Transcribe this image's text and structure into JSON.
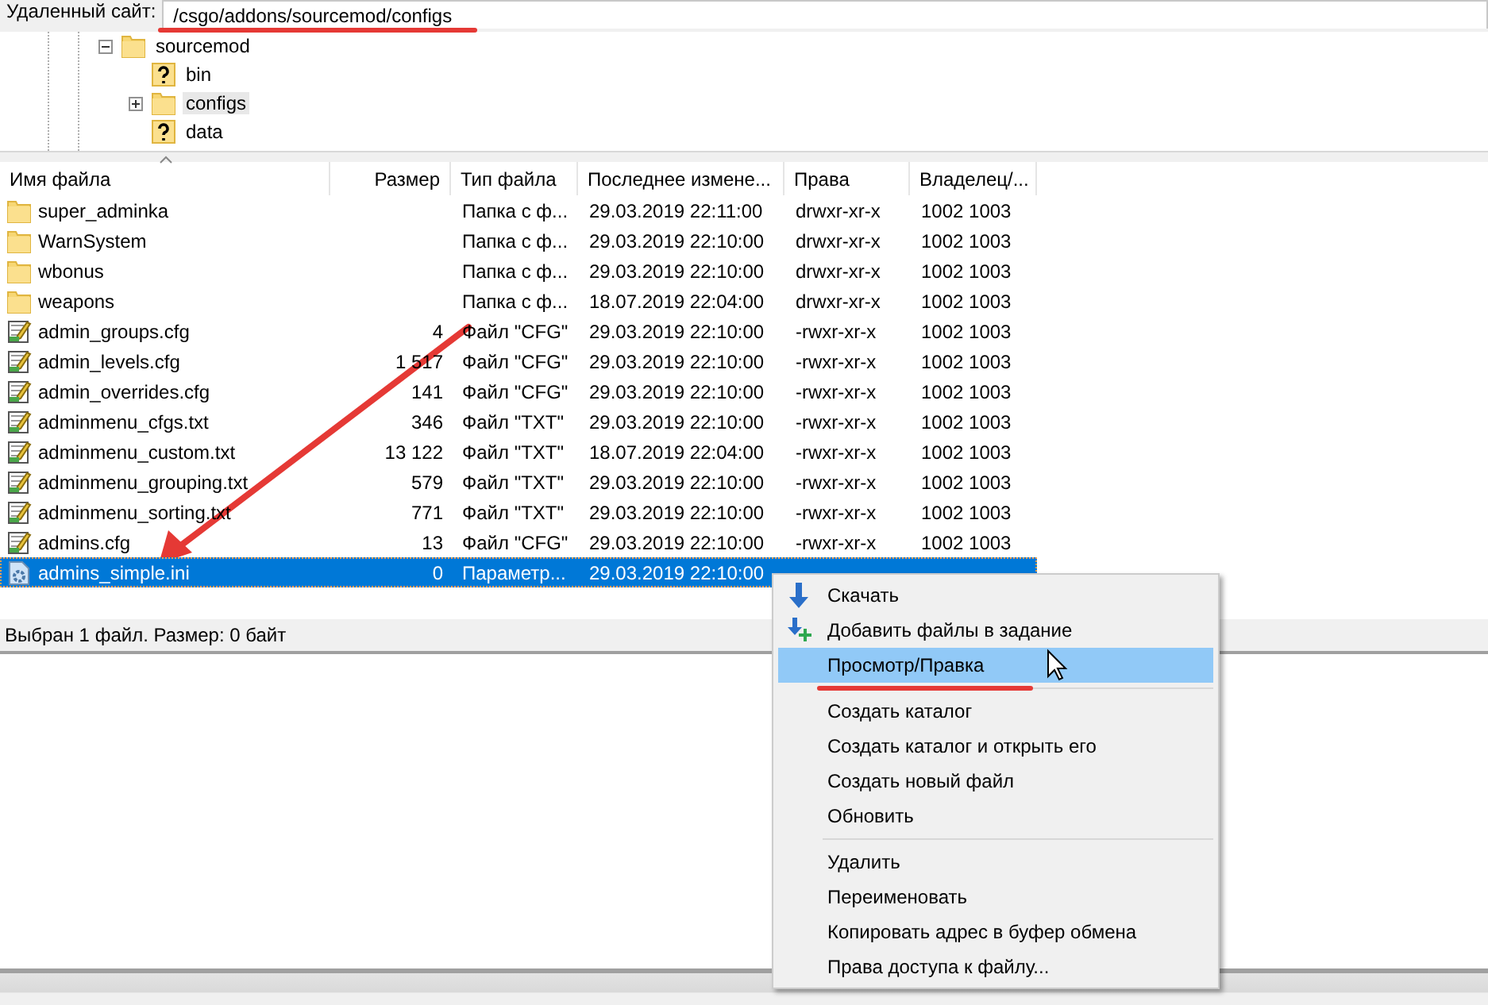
{
  "remote_site": {
    "label": "Удаленный сайт:",
    "path": "/csgo/addons/sourcemod/configs"
  },
  "tree": [
    {
      "name": "sourcemod",
      "kind": "folder",
      "expanded": true,
      "selected": false,
      "children": [
        {
          "name": "bin",
          "kind": "unknown",
          "selected": false
        },
        {
          "name": "configs",
          "kind": "folder",
          "expanded": false,
          "selected": true
        },
        {
          "name": "data",
          "kind": "unknown",
          "selected": false
        }
      ]
    }
  ],
  "table": {
    "columns": [
      "Имя файла",
      "Размер",
      "Тип файла",
      "Последнее измене...",
      "Права",
      "Владелец/..."
    ],
    "rows": [
      {
        "kind": "folder",
        "name": "super_adminka",
        "size": "",
        "type": "Папка с ф...",
        "modified": "29.03.2019 22:11:00",
        "rights": "drwxr-xr-x",
        "owner": "1002 1003",
        "selected": false
      },
      {
        "kind": "folder",
        "name": "WarnSystem",
        "size": "",
        "type": "Папка с ф...",
        "modified": "29.03.2019 22:10:00",
        "rights": "drwxr-xr-x",
        "owner": "1002 1003",
        "selected": false
      },
      {
        "kind": "folder",
        "name": "wbonus",
        "size": "",
        "type": "Папка с ф...",
        "modified": "29.03.2019 22:10:00",
        "rights": "drwxr-xr-x",
        "owner": "1002 1003",
        "selected": false
      },
      {
        "kind": "folder",
        "name": "weapons",
        "size": "",
        "type": "Папка с ф...",
        "modified": "18.07.2019 22:04:00",
        "rights": "drwxr-xr-x",
        "owner": "1002 1003",
        "selected": false
      },
      {
        "kind": "text",
        "name": "admin_groups.cfg",
        "size": "4",
        "type": "Файл \"CFG\"",
        "modified": "29.03.2019 22:10:00",
        "rights": "-rwxr-xr-x",
        "owner": "1002 1003",
        "selected": false
      },
      {
        "kind": "text",
        "name": "admin_levels.cfg",
        "size": "1 517",
        "type": "Файл \"CFG\"",
        "modified": "29.03.2019 22:10:00",
        "rights": "-rwxr-xr-x",
        "owner": "1002 1003",
        "selected": false
      },
      {
        "kind": "text",
        "name": "admin_overrides.cfg",
        "size": "141",
        "type": "Файл \"CFG\"",
        "modified": "29.03.2019 22:10:00",
        "rights": "-rwxr-xr-x",
        "owner": "1002 1003",
        "selected": false
      },
      {
        "kind": "text",
        "name": "adminmenu_cfgs.txt",
        "size": "346",
        "type": "Файл \"TXT\"",
        "modified": "29.03.2019 22:10:00",
        "rights": "-rwxr-xr-x",
        "owner": "1002 1003",
        "selected": false
      },
      {
        "kind": "text",
        "name": "adminmenu_custom.txt",
        "size": "13 122",
        "type": "Файл \"TXT\"",
        "modified": "18.07.2019 22:04:00",
        "rights": "-rwxr-xr-x",
        "owner": "1002 1003",
        "selected": false
      },
      {
        "kind": "text",
        "name": "adminmenu_grouping.txt",
        "size": "579",
        "type": "Файл \"TXT\"",
        "modified": "29.03.2019 22:10:00",
        "rights": "-rwxr-xr-x",
        "owner": "1002 1003",
        "selected": false
      },
      {
        "kind": "text",
        "name": "adminmenu_sorting.txt",
        "size": "771",
        "type": "Файл \"TXT\"",
        "modified": "29.03.2019 22:10:00",
        "rights": "-rwxr-xr-x",
        "owner": "1002 1003",
        "selected": false
      },
      {
        "kind": "text",
        "name": "admins.cfg",
        "size": "13",
        "type": "Файл \"CFG\"",
        "modified": "29.03.2019 22:10:00",
        "rights": "-rwxr-xr-x",
        "owner": "1002 1003",
        "selected": false
      },
      {
        "kind": "settings",
        "name": "admins_simple.ini",
        "size": "0",
        "type": "Параметр...",
        "modified": "29.03.2019 22:10:00",
        "selected": true
      }
    ]
  },
  "status": "Выбран 1 файл. Размер: 0 байт",
  "context_menu": {
    "groups": [
      [
        {
          "kind": "download",
          "label": "Скачать",
          "selected": false
        },
        {
          "kind": "add",
          "label": "Добавить файлы в задание",
          "selected": false
        },
        {
          "kind": "plain",
          "label": "Просмотр/Правка",
          "selected": true
        }
      ],
      [
        {
          "kind": "plain",
          "label": "Создать каталог",
          "selected": false
        },
        {
          "kind": "plain",
          "label": "Создать каталог и открыть его",
          "selected": false
        },
        {
          "kind": "plain",
          "label": "Создать новый файл",
          "selected": false
        },
        {
          "kind": "plain",
          "label": "Обновить",
          "selected": false
        }
      ],
      [
        {
          "kind": "plain",
          "label": "Удалить",
          "selected": false
        },
        {
          "kind": "plain",
          "label": "Переименовать",
          "selected": false
        },
        {
          "kind": "plain",
          "label": "Копировать адрес в буфер обмена",
          "selected": false
        },
        {
          "kind": "plain",
          "label": "Права доступа к файлу...",
          "selected": false
        }
      ]
    ]
  }
}
